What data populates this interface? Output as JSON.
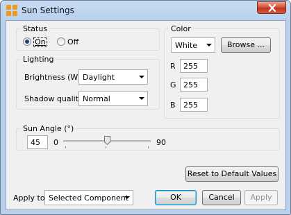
{
  "window": {
    "title": "Sun Settings"
  },
  "status": {
    "legend": "Status",
    "on_label": "On",
    "off_label": "Off",
    "selected": "On"
  },
  "lighting": {
    "legend": "Lighting",
    "brightness_label": "Brightness (W)",
    "brightness_value": "Daylight",
    "shadow_label": "Shadow quality",
    "shadow_value": "Normal"
  },
  "color": {
    "legend": "Color",
    "preset_value": "White",
    "browse_label": "Browse ...",
    "r_label": "R",
    "r_value": "255",
    "g_label": "G",
    "g_value": "255",
    "b_label": "B",
    "b_value": "255"
  },
  "sun_angle": {
    "legend": "Sun Angle (°)",
    "value": "45",
    "min_label": "0",
    "max_label": "90",
    "level_fraction": 0.5
  },
  "reset_label": "Reset to Default Values",
  "apply_to": {
    "label": "Apply to",
    "value": "Selected Component"
  },
  "buttons": {
    "ok": "OK",
    "cancel": "Cancel",
    "apply": "Apply"
  }
}
